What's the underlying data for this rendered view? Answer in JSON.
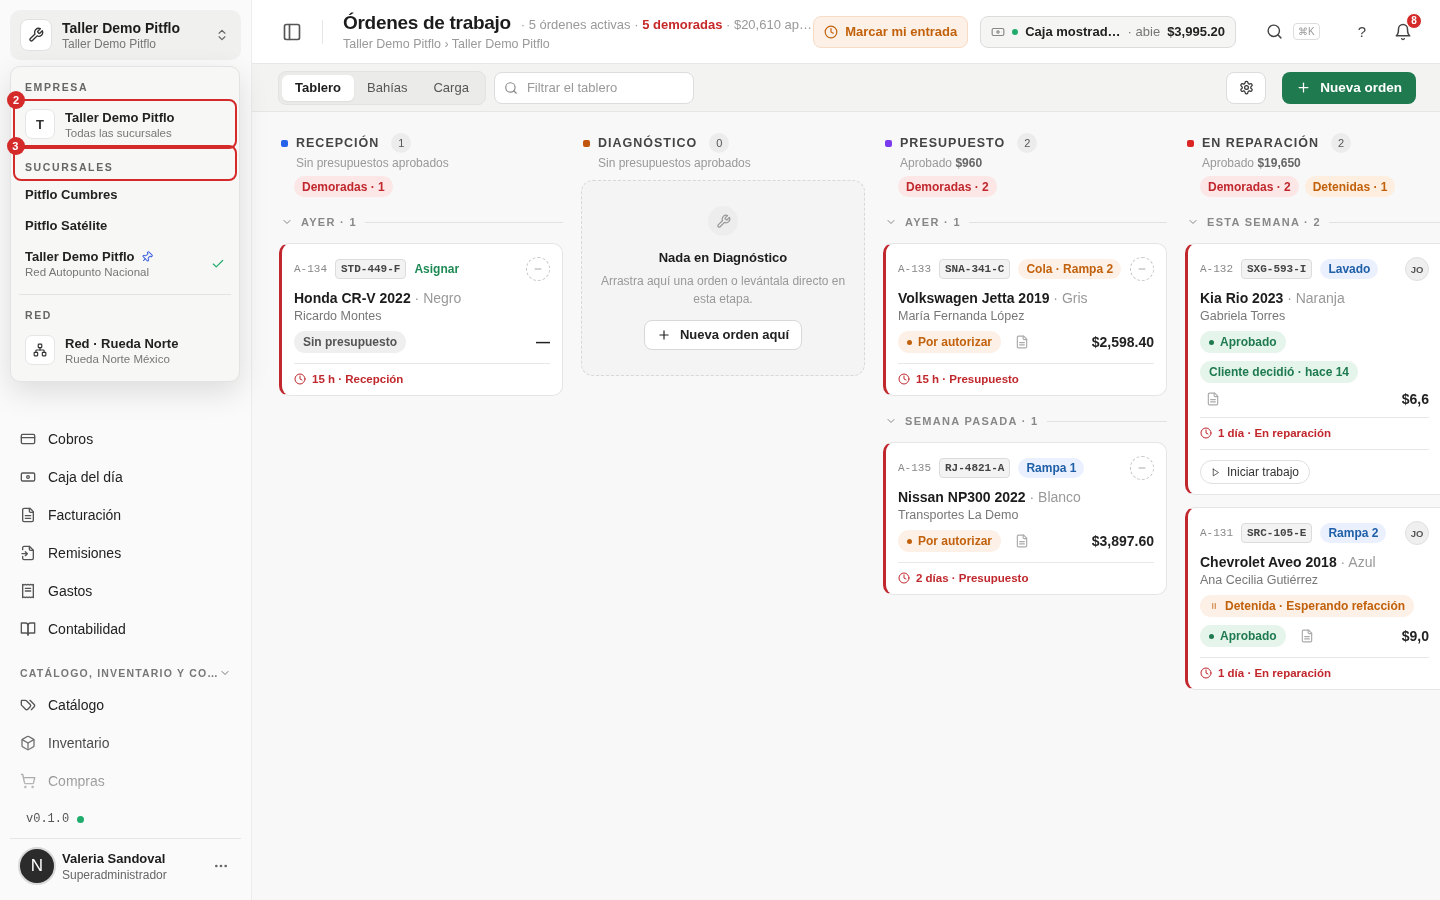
{
  "sidebar": {
    "switcher": {
      "title": "Taller Demo Pitflo",
      "subtitle": "Taller Demo Pitflo"
    },
    "dropdown": {
      "sections": [
        {
          "heading": "EMPRESA",
          "items": [
            {
              "kind": "org",
              "avatar": "T",
              "title": "Taller Demo Pitflo",
              "subtitle": "Todas las sucursales",
              "selected": false,
              "pinned": false,
              "annotation": "2"
            }
          ]
        },
        {
          "heading": "SUCURSALES",
          "annotation": "3",
          "items": [
            {
              "kind": "branch",
              "title": "Pitflo Cumbres",
              "selected": false,
              "pinned": false
            },
            {
              "kind": "branch",
              "title": "Pitflo Satélite",
              "selected": false,
              "pinned": false
            },
            {
              "kind": "branch",
              "title": "Taller Demo Pitflo",
              "subtitle": "Red Autopunto Nacional",
              "selected": true,
              "pinned": true
            }
          ]
        },
        {
          "heading": "RED",
          "items": [
            {
              "kind": "network",
              "title": "Red · Rueda Norte",
              "subtitle": "Rueda Norte México",
              "selected": false,
              "pinned": false
            }
          ]
        }
      ]
    },
    "nav_items": [
      {
        "label": "Cobros"
      },
      {
        "label": "Caja del día"
      },
      {
        "label": "Facturación"
      },
      {
        "label": "Remisiones"
      },
      {
        "label": "Gastos"
      },
      {
        "label": "Contabilidad"
      }
    ],
    "catalog_section": {
      "heading": "CATÁLOGO, INVENTARIO Y CO…",
      "expanded": true,
      "items": [
        {
          "label": "Catálogo"
        },
        {
          "label": "Inventario"
        },
        {
          "label": "Compras"
        }
      ]
    },
    "version": "v0.1.0",
    "user": {
      "initial": "N",
      "name": "Valeria Sandoval",
      "role": "Superadministrador"
    }
  },
  "header": {
    "title": "Órdenes de trabajo",
    "stats": "· 5 órdenes activas · **5 demoradas** · $20,610 ap…",
    "breadcrumb": "Taller Demo Pitflo › Taller Demo Pitflo",
    "clock_in": "Marcar mi entrada",
    "cash_register": {
      "name": "Caja mostrad…",
      "status": "· abie",
      "amount": "$3,995.20"
    },
    "shortcut": "⌘K",
    "help": "?",
    "notifications": "8"
  },
  "toolbar": {
    "tabs": [
      {
        "label": "Tablero",
        "selected": true
      },
      {
        "label": "Bahías",
        "selected": false
      },
      {
        "label": "Carga",
        "selected": false
      }
    ],
    "filter": {
      "placeholder": "Filtrar el tablero"
    },
    "new_order": "Nueva orden"
  },
  "columns": [
    {
      "title": "RECEPCIÓN",
      "color": "#2563eb",
      "count": "1",
      "subtitle": "Sin presupuestos aprobados",
      "chips": [
        {
          "label": "Demoradas · 1",
          "kind": "delayed"
        }
      ],
      "groups": [
        {
          "label": "AYER · 1",
          "expanded": true,
          "cards": [
            {
              "id": "A-134",
              "plate": "STD-449-F",
              "tag": {
                "label": "Asignar",
                "kind": "action"
              },
              "delayed": true,
              "vehicle": "**Honda CR-V 2022** · Negro",
              "customer": "Ricardo Montes",
              "rows": [
                {
                  "pills": [
                    {
                      "label": "Sin presupuesto",
                      "kind": "plain"
                    }
                  ],
                  "document": false,
                  "amount": "—"
                }
              ],
              "footer": "15 h · Recepción"
            }
          ]
        }
      ]
    },
    {
      "title": "DIAGNÓSTICO",
      "color": "#c2560e",
      "count": "0",
      "subtitle": "Sin presupuestos aprobados",
      "empty": {
        "title": "Nada en Diagnóstico",
        "text": "Arrastra aquí una orden o levántala directo en esta etapa.",
        "button": "Nueva orden aquí"
      }
    },
    {
      "title": "PRESUPUESTO",
      "color": "#7c3aed",
      "count": "2",
      "subtitle": "Aprobado **$960**",
      "chips": [
        {
          "label": "Demoradas · 2",
          "kind": "delayed"
        }
      ],
      "groups": [
        {
          "label": "AYER · 1",
          "expanded": true,
          "cards": [
            {
              "id": "A-133",
              "plate": "SNA-341-C",
              "tag": {
                "label": "Cola · Rampa 2",
                "kind": "queue"
              },
              "delayed": true,
              "vehicle": "**Volkswagen Jetta 2019** · Gris",
              "customer": "María Fernanda López",
              "rows": [
                {
                  "pills": [
                    {
                      "label": "Por autorizar",
                      "kind": "pending"
                    }
                  ],
                  "document": true,
                  "amount": "$2,598.40"
                }
              ],
              "footer": "15 h · Presupuesto"
            }
          ]
        },
        {
          "label": "SEMANA PASADA · 1",
          "expanded": true,
          "cards": [
            {
              "id": "A-135",
              "plate": "RJ-4821-A",
              "tag": {
                "label": "Rampa 1",
                "kind": "bay"
              },
              "delayed": true,
              "vehicle": "**Nissan NP300 2022** · Blanco",
              "customer": "Transportes La Demo",
              "rows": [
                {
                  "pills": [
                    {
                      "label": "Por autorizar",
                      "kind": "pending"
                    }
                  ],
                  "document": true,
                  "amount": "$3,897.60"
                }
              ],
              "footer": "2 días · Presupuesto"
            }
          ]
        }
      ]
    },
    {
      "title": "EN REPARACIÓN",
      "color": "#dc2626",
      "count": "2",
      "subtitle": "Aprobado **$19,650**",
      "chips": [
        {
          "label": "Demoradas · 2",
          "kind": "delayed"
        },
        {
          "label": "Detenidas · 1",
          "kind": "stopped"
        }
      ],
      "groups": [
        {
          "label": "ESTA SEMANA · 2",
          "expanded": true,
          "cards": [
            {
              "id": "A-132",
              "plate": "SXG-593-I",
              "tag": {
                "label": "Lavado",
                "kind": "bay"
              },
              "assignee": "JO",
              "delayed": true,
              "vehicle": "**Kia Rio 2023** · Naranja",
              "customer": "Gabriela Torres",
              "rows": [
                {
                  "pills": [
                    {
                      "label": "Aprobado",
                      "kind": "approved"
                    },
                    {
                      "label": "Cliente decidió · hace 14",
                      "kind": "decision"
                    }
                  ],
                  "document": false
                },
                {
                  "document": true,
                  "amount": "$6,6"
                }
              ],
              "footer": "1 día · En reparación",
              "action": "Iniciar trabajo"
            },
            {
              "id": "A-131",
              "plate": "SRC-105-E",
              "tag": {
                "label": "Rampa 2",
                "kind": "bay"
              },
              "assignee": "JO",
              "delayed": true,
              "vehicle": "**Chevrolet Aveo 2018** · Azul",
              "customer": "Ana Cecilia Gutiérrez",
              "rows": [
                {
                  "pills": [
                    {
                      "label": "Detenida · Esperando refacción",
                      "kind": "on-hold"
                    }
                  ],
                  "document": false
                },
                {
                  "pills": [
                    {
                      "label": "Aprobado",
                      "kind": "approved"
                    }
                  ],
                  "document": true,
                  "amount": "$9,0"
                }
              ],
              "footer": "1 día · En reparación"
            }
          ]
        }
      ]
    }
  ]
}
